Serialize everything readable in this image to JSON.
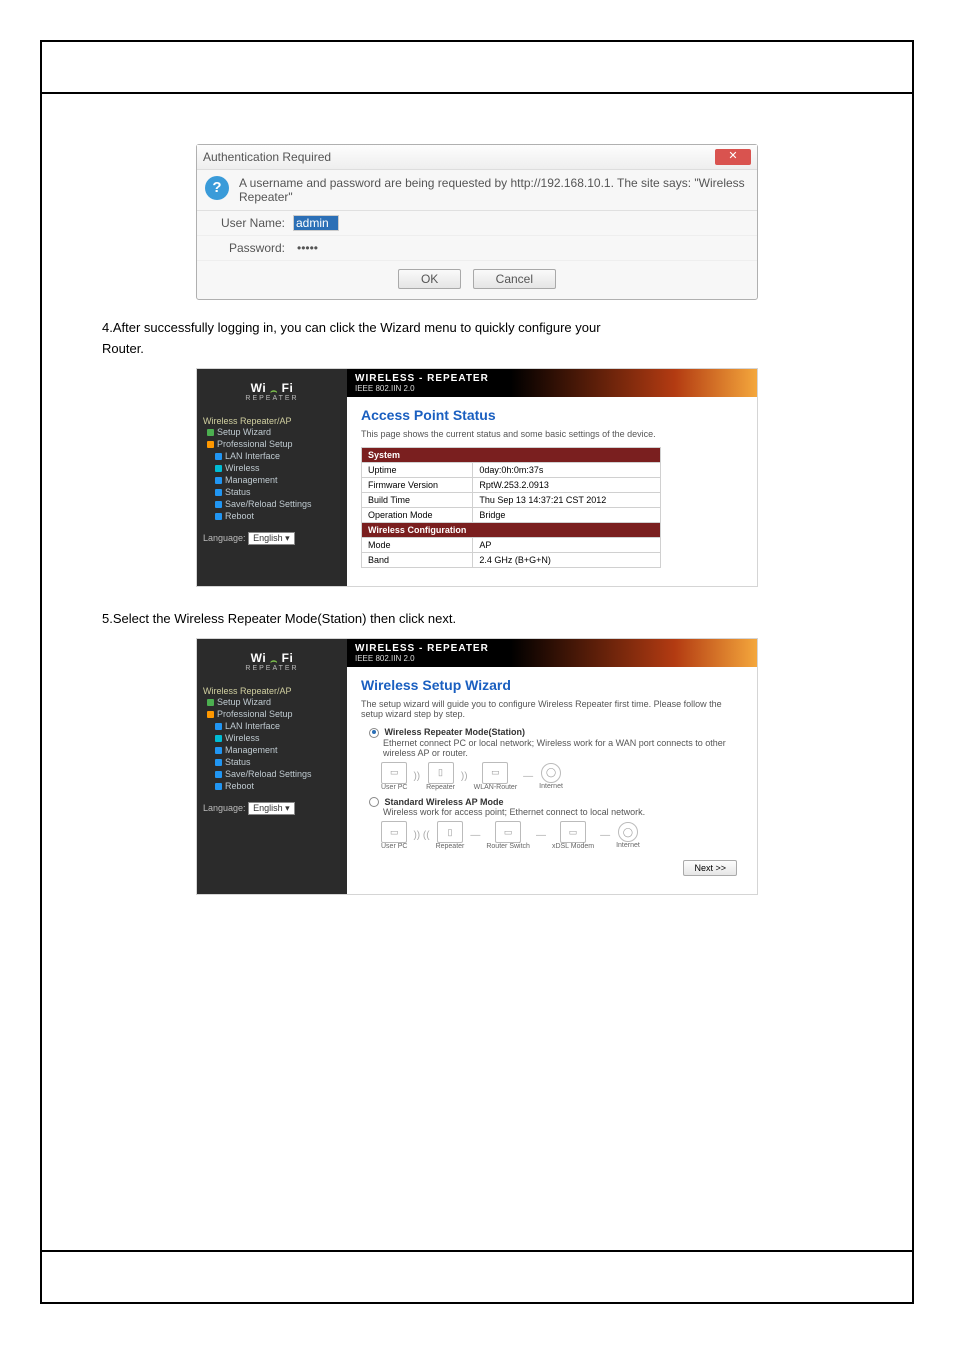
{
  "instructions": {
    "line1": "4.After successfully logging in, you can click the Wizard menu to quickly configure your",
    "line2": "Router.",
    "line3": "5.Select the Wireless Repeater Mode(Station) then click next."
  },
  "auth_dialog": {
    "title": "Authentication Required",
    "close_glyph": "✕",
    "question_glyph": "?",
    "message": "A username and password are being requested by http://192.168.10.1. The site says: \"Wireless Repeater\"",
    "username_label": "User Name:",
    "username_value": "admin",
    "password_label": "Password:",
    "password_value": "•••••",
    "ok_label": "OK",
    "cancel_label": "Cancel"
  },
  "router": {
    "logo_main": "Wi Fi",
    "logo_sub": "REPEATER",
    "banner_title": "WIRELESS - REPEATER",
    "banner_sub": "IEEE 802.IIN 2.0",
    "nav_heading": "Wireless Repeater/AP",
    "nav_wizard": "Setup Wizard",
    "nav_prof": "Professional Setup",
    "nav_items": [
      "LAN Interface",
      "Wireless",
      "Management",
      "Status",
      "Save/Reload Settings",
      "Reboot"
    ],
    "lang_label": "Language:",
    "lang_value": "English ▾"
  },
  "status_page": {
    "title": "Access Point Status",
    "note": "This page shows the current status and some basic settings of the device.",
    "section_system": "System",
    "rows_system": [
      [
        "Uptime",
        "0day:0h:0m:37s"
      ],
      [
        "Firmware Version",
        "RptW.253.2.0913"
      ],
      [
        "Build Time",
        "Thu Sep 13 14:37:21 CST 2012"
      ],
      [
        "Operation Mode",
        "Bridge"
      ]
    ],
    "section_wireless": "Wireless Configuration",
    "rows_wireless": [
      [
        "Mode",
        "AP"
      ],
      [
        "Band",
        "2.4 GHz (B+G+N)"
      ]
    ]
  },
  "wizard_page": {
    "title": "Wireless Setup Wizard",
    "note": "The setup wizard will guide you to configure Wireless Repeater first time. Please follow the setup wizard step by step.",
    "opt1_title": "Wireless Repeater Mode(Station)",
    "opt1_desc": "Ethernet connect PC or local network; Wireless work for a WAN port connects to other wireless AP or router.",
    "opt2_title": "Standard Wireless AP Mode",
    "opt2_desc": "Wireless work for access point; Ethernet connect to local network.",
    "diag1": [
      "User PC",
      "Repeater",
      "WLAN-Router",
      "Internet"
    ],
    "diag2": [
      "User PC",
      "Repeater",
      "Router Switch",
      "xDSL Modem",
      "Internet"
    ],
    "next_label": "Next >>"
  }
}
